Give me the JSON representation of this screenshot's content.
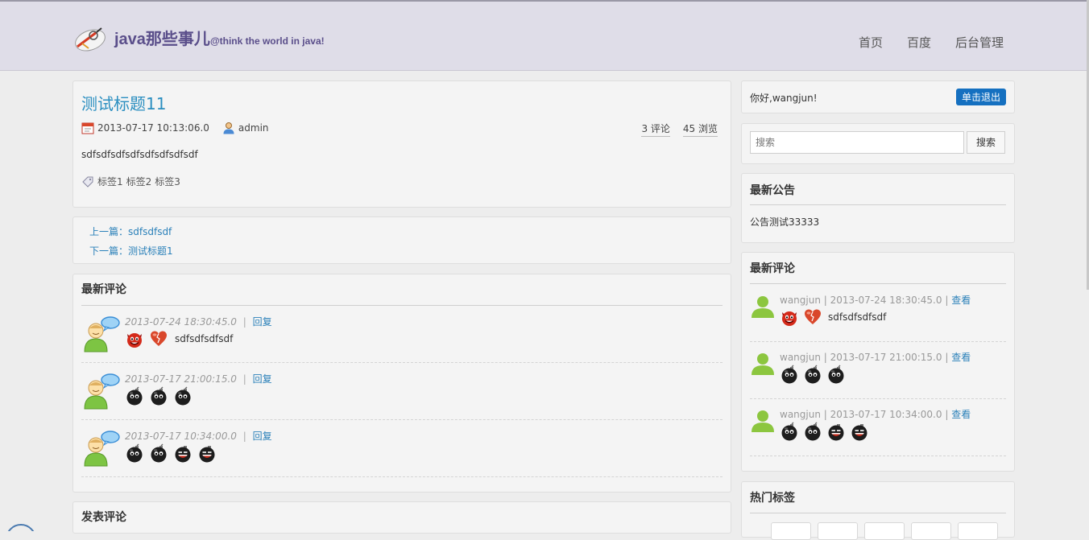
{
  "header": {
    "site_name": "java那些事儿",
    "slogan": "@think the world in java!",
    "nav": [
      "首页",
      "百度",
      "后台管理"
    ]
  },
  "post": {
    "title": "测试标题11",
    "date": "2013-07-17 10:13:06.0",
    "author": "admin",
    "comments": "3 评论",
    "views": "45 浏览",
    "body": "sdfsdfsdfsdfsdfsdfsdfsdf",
    "tags": [
      "标签1",
      "标签2",
      "标签3"
    ]
  },
  "prevnext": {
    "prev": "上一篇：sdfsdfsdf",
    "next": "下一篇：测试标题1"
  },
  "comments": {
    "title": "最新评论",
    "reply_label": "回复",
    "items": [
      {
        "date": "2013-07-24 18:30:45.0",
        "emoticons": [
          "devil-emoticon",
          "broken-heart-emoticon"
        ],
        "text": "sdfsdfsdfsdf"
      },
      {
        "date": "2013-07-17 21:00:15.0",
        "emoticons": [
          "bomb-emoticon",
          "bomb-emoticon",
          "bomb-emoticon"
        ],
        "text": ""
      },
      {
        "date": "2013-07-17 10:34:00.0",
        "emoticons": [
          "bomb-emoticon",
          "bomb-emoticon",
          "laughing-bomb-emoticon",
          "laughing-bomb-emoticon"
        ],
        "text": ""
      }
    ]
  },
  "post_comment": {
    "title": "发表评论"
  },
  "sidebar": {
    "greeting": "你好,wangjun!",
    "logout": "单击退出",
    "search_placeholder": "搜索",
    "search_button": "搜索",
    "notice_title": "最新公告",
    "notice": "公告测试33333",
    "recent_title": "最新评论",
    "view_label": "查看",
    "recent": [
      {
        "head": "wangjun | 2013-07-24 18:30:45.0 | ",
        "text": "sdfsdfsdfsdf"
      },
      {
        "head": "wangjun | 2013-07-17 21:00:15.0 | ",
        "text": ""
      },
      {
        "head": "wangjun | 2013-07-17 10:34:00.0 | ",
        "text": ""
      }
    ],
    "hot_tags_title": "热门标签"
  },
  "colors": {
    "accent": "#2a8ec0",
    "brand": "#5a4e8a",
    "button": "#1570c0"
  }
}
